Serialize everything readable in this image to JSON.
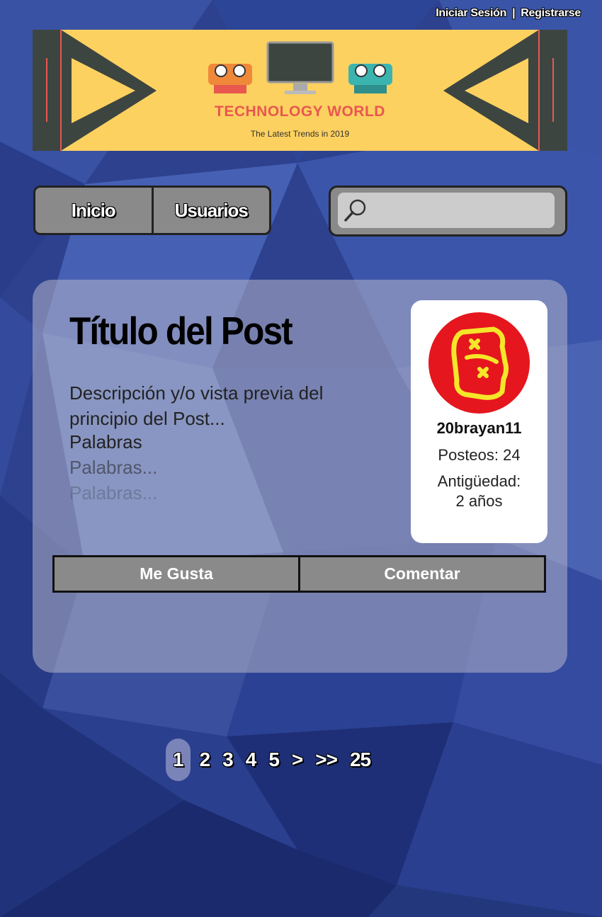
{
  "header": {
    "login": "Iniciar Sesión",
    "separator": "|",
    "register": "Registrarse"
  },
  "banner": {
    "title": "TECHNOLOGY WORLD",
    "subtitle": "The Latest Trends in 2019"
  },
  "nav": {
    "items": [
      {
        "label": "Inicio"
      },
      {
        "label": "Usuarios"
      }
    ]
  },
  "search": {
    "icon": "search-icon",
    "value": ""
  },
  "post": {
    "title": "Título del Post",
    "description": "Descripción y/o vista previa del principio del Post...",
    "lines": [
      "Palabras",
      "Palabras...",
      "Palabras..."
    ],
    "author": {
      "username": "20brayan11",
      "posts": "Posteos: 24",
      "age_label": "Antigüedad:",
      "age_value": "2 años"
    },
    "actions": {
      "like": "Me Gusta",
      "comment": "Comentar"
    }
  },
  "pagination": {
    "items": [
      "1",
      "2",
      "3",
      "4",
      "5",
      ">",
      ">>",
      "25"
    ],
    "active": "1"
  },
  "colors": {
    "background": "#2b3f8c",
    "banner": "#fdd160",
    "banner_title": "#e8584f",
    "button_gray": "#8a8a8a",
    "avatar_red": "#e5161e",
    "avatar_yellow": "#f5e62a"
  }
}
